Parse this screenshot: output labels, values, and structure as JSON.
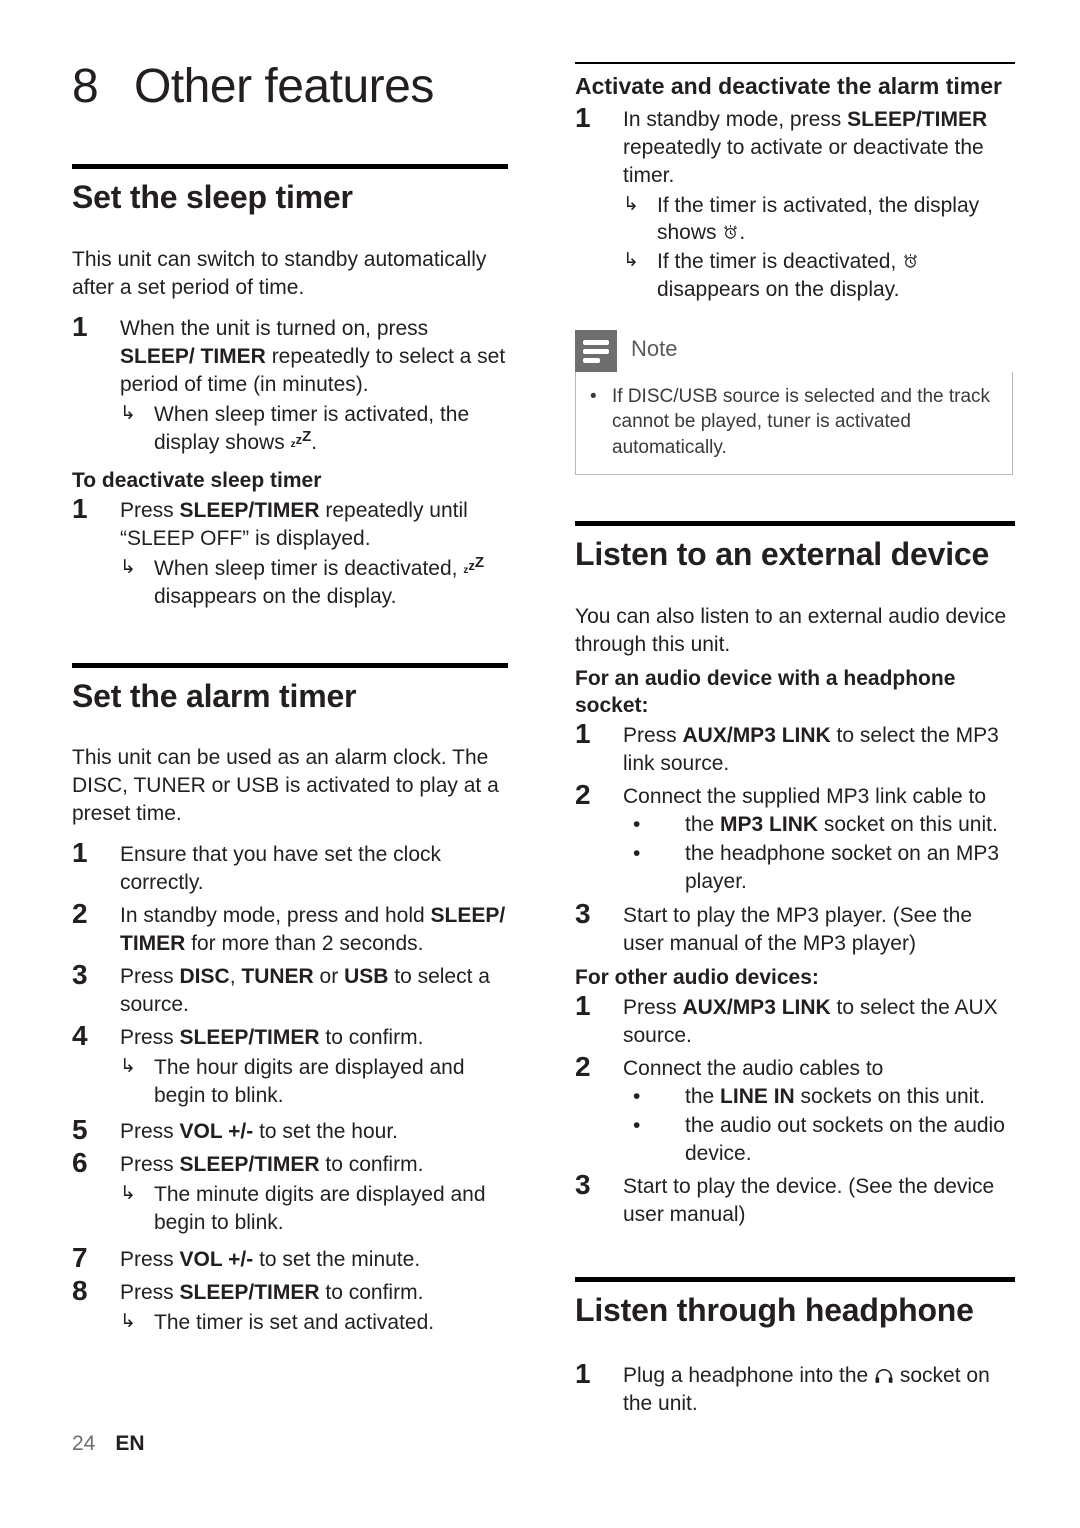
{
  "chapter": {
    "number": "8",
    "title": "Other features"
  },
  "left_column": {
    "sleep_timer": {
      "heading": "Set the sleep timer",
      "intro": "This unit can switch to standby automatically after a set period of time.",
      "steps": [
        {
          "number": "1",
          "parts": [
            {
              "t": "When the unit is turned on, press ",
              "b": false
            },
            {
              "t": "SLEEP/ TIMER",
              "b": true
            },
            {
              "t": " repeatedly to select a set period of time (in minutes).",
              "b": false
            }
          ],
          "arrows": [
            {
              "parts": [
                {
                  "t": "When sleep timer is activated, the display shows ",
                  "b": false
                },
                {
                  "t": "ZZZ_ICON",
                  "icon": "sleep-zzz-icon"
                },
                {
                  "t": ".",
                  "b": false
                }
              ]
            }
          ]
        }
      ],
      "deactivate_heading": "To deactivate sleep timer",
      "deactivate_steps": [
        {
          "number": "1",
          "parts": [
            {
              "t": "Press ",
              "b": false
            },
            {
              "t": "SLEEP/TIMER",
              "b": true
            },
            {
              "t": " repeatedly until “SLEEP OFF” is displayed.",
              "b": false
            }
          ],
          "arrows": [
            {
              "parts": [
                {
                  "t": "When sleep timer is deactivated, ",
                  "b": false
                },
                {
                  "t": "ZZZ_ICON",
                  "icon": "sleep-zzz-icon"
                },
                {
                  "t": " disappears on the display.",
                  "b": false
                }
              ]
            }
          ]
        }
      ]
    },
    "alarm_timer": {
      "heading": "Set the alarm timer",
      "intro": "This unit can be used as an alarm clock. The DISC, TUNER or USB is activated to play at a preset time.",
      "steps": [
        {
          "number": "1",
          "parts": [
            {
              "t": "Ensure that you have set the clock correctly.",
              "b": false
            }
          ],
          "arrows": []
        },
        {
          "number": "2",
          "parts": [
            {
              "t": "In standby mode, press and hold ",
              "b": false
            },
            {
              "t": "SLEEP/ TIMER",
              "b": true
            },
            {
              "t": " for more than 2 seconds.",
              "b": false
            }
          ],
          "arrows": []
        },
        {
          "number": "3",
          "parts": [
            {
              "t": "Press ",
              "b": false
            },
            {
              "t": "DISC",
              "b": true
            },
            {
              "t": ", ",
              "b": false
            },
            {
              "t": "TUNER",
              "b": true
            },
            {
              "t": " or ",
              "b": false
            },
            {
              "t": "USB",
              "b": true
            },
            {
              "t": " to select a source.",
              "b": false
            }
          ],
          "arrows": []
        },
        {
          "number": "4",
          "parts": [
            {
              "t": "Press ",
              "b": false
            },
            {
              "t": "SLEEP/TIMER",
              "b": true
            },
            {
              "t": " to confirm.",
              "b": false
            }
          ],
          "arrows": [
            {
              "parts": [
                {
                  "t": "The hour digits are displayed and begin to blink.",
                  "b": false
                }
              ]
            }
          ]
        },
        {
          "number": "5",
          "parts": [
            {
              "t": "Press ",
              "b": false
            },
            {
              "t": "VOL +/-",
              "b": true
            },
            {
              "t": " to set the hour.",
              "b": false
            }
          ],
          "arrows": []
        },
        {
          "number": "6",
          "parts": [
            {
              "t": "Press ",
              "b": false
            },
            {
              "t": "SLEEP/TIMER",
              "b": true
            },
            {
              "t": " to confirm.",
              "b": false
            }
          ],
          "arrows": [
            {
              "parts": [
                {
                  "t": "The minute digits are displayed and begin to blink.",
                  "b": false
                }
              ]
            }
          ]
        },
        {
          "number": "7",
          "parts": [
            {
              "t": "Press ",
              "b": false
            },
            {
              "t": "VOL +/-",
              "b": true
            },
            {
              "t": " to set the minute.",
              "b": false
            }
          ],
          "arrows": []
        },
        {
          "number": "8",
          "parts": [
            {
              "t": "Press ",
              "b": false
            },
            {
              "t": "SLEEP/TIMER",
              "b": true
            },
            {
              "t": " to confirm.",
              "b": false
            }
          ],
          "arrows": [
            {
              "parts": [
                {
                  "t": "The timer is set and activated.",
                  "b": false
                }
              ]
            }
          ]
        }
      ]
    }
  },
  "right_column": {
    "activate_alarm": {
      "heading": "Activate and deactivate the alarm timer",
      "steps": [
        {
          "number": "1",
          "parts": [
            {
              "t": "In standby mode, press ",
              "b": false
            },
            {
              "t": "SLEEP/TIMER",
              "b": true
            },
            {
              "t": " repeatedly to activate or deactivate the timer.",
              "b": false
            }
          ],
          "arrows": [
            {
              "parts": [
                {
                  "t": "If the timer is activated, the display shows ",
                  "b": false
                },
                {
                  "t": "ALARM_ICON",
                  "icon": "alarm-clock-icon"
                },
                {
                  "t": ".",
                  "b": false
                }
              ]
            },
            {
              "parts": [
                {
                  "t": "If the timer is deactivated, ",
                  "b": false
                },
                {
                  "t": "ALARM_ICON",
                  "icon": "alarm-clock-icon"
                },
                {
                  "t": " disappears on the display.",
                  "b": false
                }
              ]
            }
          ]
        }
      ]
    },
    "note": {
      "label": "Note",
      "bullet_char": "•",
      "items": [
        "If DISC/USB source is selected and the track cannot be played, tuner is activated automatically."
      ]
    },
    "external_device": {
      "heading": "Listen to an external device",
      "intro": "You can also listen to an external audio device through this unit.",
      "sub_heading_1": "For an audio device with a headphone socket:",
      "steps_1": [
        {
          "number": "1",
          "parts": [
            {
              "t": "Press ",
              "b": false
            },
            {
              "t": "AUX/MP3 LINK",
              "b": true
            },
            {
              "t": " to select the MP3 link source.",
              "b": false
            }
          ],
          "dots": []
        },
        {
          "number": "2",
          "parts": [
            {
              "t": "Connect the supplied MP3 link cable to",
              "b": false
            }
          ],
          "dots": [
            {
              "parts": [
                {
                  "t": "the ",
                  "b": false
                },
                {
                  "t": "MP3 LINK",
                  "b": true
                },
                {
                  "t": " socket on this unit.",
                  "b": false
                }
              ]
            },
            {
              "parts": [
                {
                  "t": "the headphone socket on an MP3 player.",
                  "b": false
                }
              ]
            }
          ]
        },
        {
          "number": "3",
          "parts": [
            {
              "t": "Start to play the MP3 player. (See the user manual of the MP3 player)",
              "b": false
            }
          ],
          "dots": []
        }
      ],
      "sub_heading_2": "For other audio devices:",
      "steps_2": [
        {
          "number": "1",
          "parts": [
            {
              "t": "Press ",
              "b": false
            },
            {
              "t": "AUX/MP3 LINK",
              "b": true
            },
            {
              "t": " to select the AUX source.",
              "b": false
            }
          ],
          "dots": []
        },
        {
          "number": "2",
          "parts": [
            {
              "t": "Connect the audio cables to",
              "b": false
            }
          ],
          "dots": [
            {
              "parts": [
                {
                  "t": "the ",
                  "b": false
                },
                {
                  "t": "LINE IN",
                  "b": true
                },
                {
                  "t": " sockets on this unit.",
                  "b": false
                }
              ]
            },
            {
              "parts": [
                {
                  "t": "the audio out sockets on the audio device.",
                  "b": false
                }
              ]
            }
          ]
        },
        {
          "number": "3",
          "parts": [
            {
              "t": "Start to play the device. (See the device user manual)",
              "b": false
            }
          ],
          "dots": []
        }
      ]
    },
    "headphone": {
      "heading": "Listen through headphone",
      "steps": [
        {
          "number": "1",
          "parts": [
            {
              "t": "Plug a headphone into the ",
              "b": false
            },
            {
              "t": "HP_ICON",
              "icon": "headphone-icon"
            },
            {
              "t": " socket on the unit.",
              "b": false
            }
          ],
          "dots": []
        }
      ]
    }
  },
  "footer": {
    "page_number": "24",
    "language": "EN"
  },
  "glyphs": {
    "arrow": "↳",
    "bullet": "•"
  },
  "colors": {
    "text": "#231f20",
    "note_tab": "#6e6e6e",
    "note_border": "#b9b9b9",
    "rule": "#000000"
  }
}
